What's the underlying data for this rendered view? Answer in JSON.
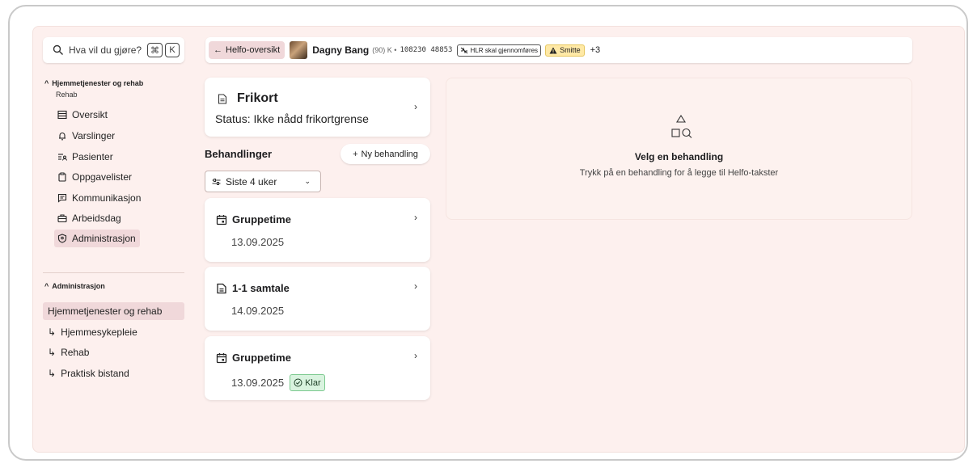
{
  "search": {
    "placeholder": "Hva vil du gjøre?",
    "key_cmd": "⌘",
    "key_k": "K"
  },
  "section1": {
    "title": "Hjemmetjenester og rehab",
    "subtitle": "Rehab",
    "items": [
      {
        "label": "Oversikt",
        "icon": "list-icon"
      },
      {
        "label": "Varslinger",
        "icon": "bell-icon"
      },
      {
        "label": "Pasienter",
        "icon": "patients-icon"
      },
      {
        "label": "Oppgavelister",
        "icon": "clipboard-icon"
      },
      {
        "label": "Kommunikasjon",
        "icon": "message-icon"
      },
      {
        "label": "Arbeidsdag",
        "icon": "briefcase-icon"
      },
      {
        "label": "Administrasjon",
        "icon": "shield-icon"
      }
    ]
  },
  "section2": {
    "title": "Administrasjon",
    "items": [
      {
        "label": "Hjemmetjenester og rehab"
      },
      {
        "label": "Hjemmesykepleie"
      },
      {
        "label": "Rehab"
      },
      {
        "label": "Praktisk bistand"
      }
    ]
  },
  "topbar": {
    "back_label": "Helfo-oversikt",
    "patient_name": "Dagny Bang",
    "patient_meta": "(90) K •",
    "patient_id": "108230 48853",
    "tag_hlr": "HLR skal gjennomføres",
    "tag_smitte": "Smitte",
    "more": "+3"
  },
  "frikort": {
    "title": "Frikort",
    "status": "Status: Ikke nådd frikortgrense"
  },
  "behandlinger": {
    "title": "Behandlinger",
    "new_label": "Ny behandling",
    "filter_label": "Siste 4 uker",
    "items": [
      {
        "title": "Gruppetime",
        "date": "13.09.2025"
      },
      {
        "title": "1-1 samtale",
        "date": "14.09.2025"
      },
      {
        "title": "Gruppetime",
        "date": "13.09.2025",
        "badge": "Klar"
      }
    ]
  },
  "empty_state": {
    "heading": "Velg en behandling",
    "text": "Trykk på en behandling for å legge til Helfo-takster"
  },
  "colors": {
    "background": "#fdf0ee",
    "active": "#f0d8da",
    "badge_ok": "#d9f3df",
    "warning": "#ffe9a6"
  }
}
